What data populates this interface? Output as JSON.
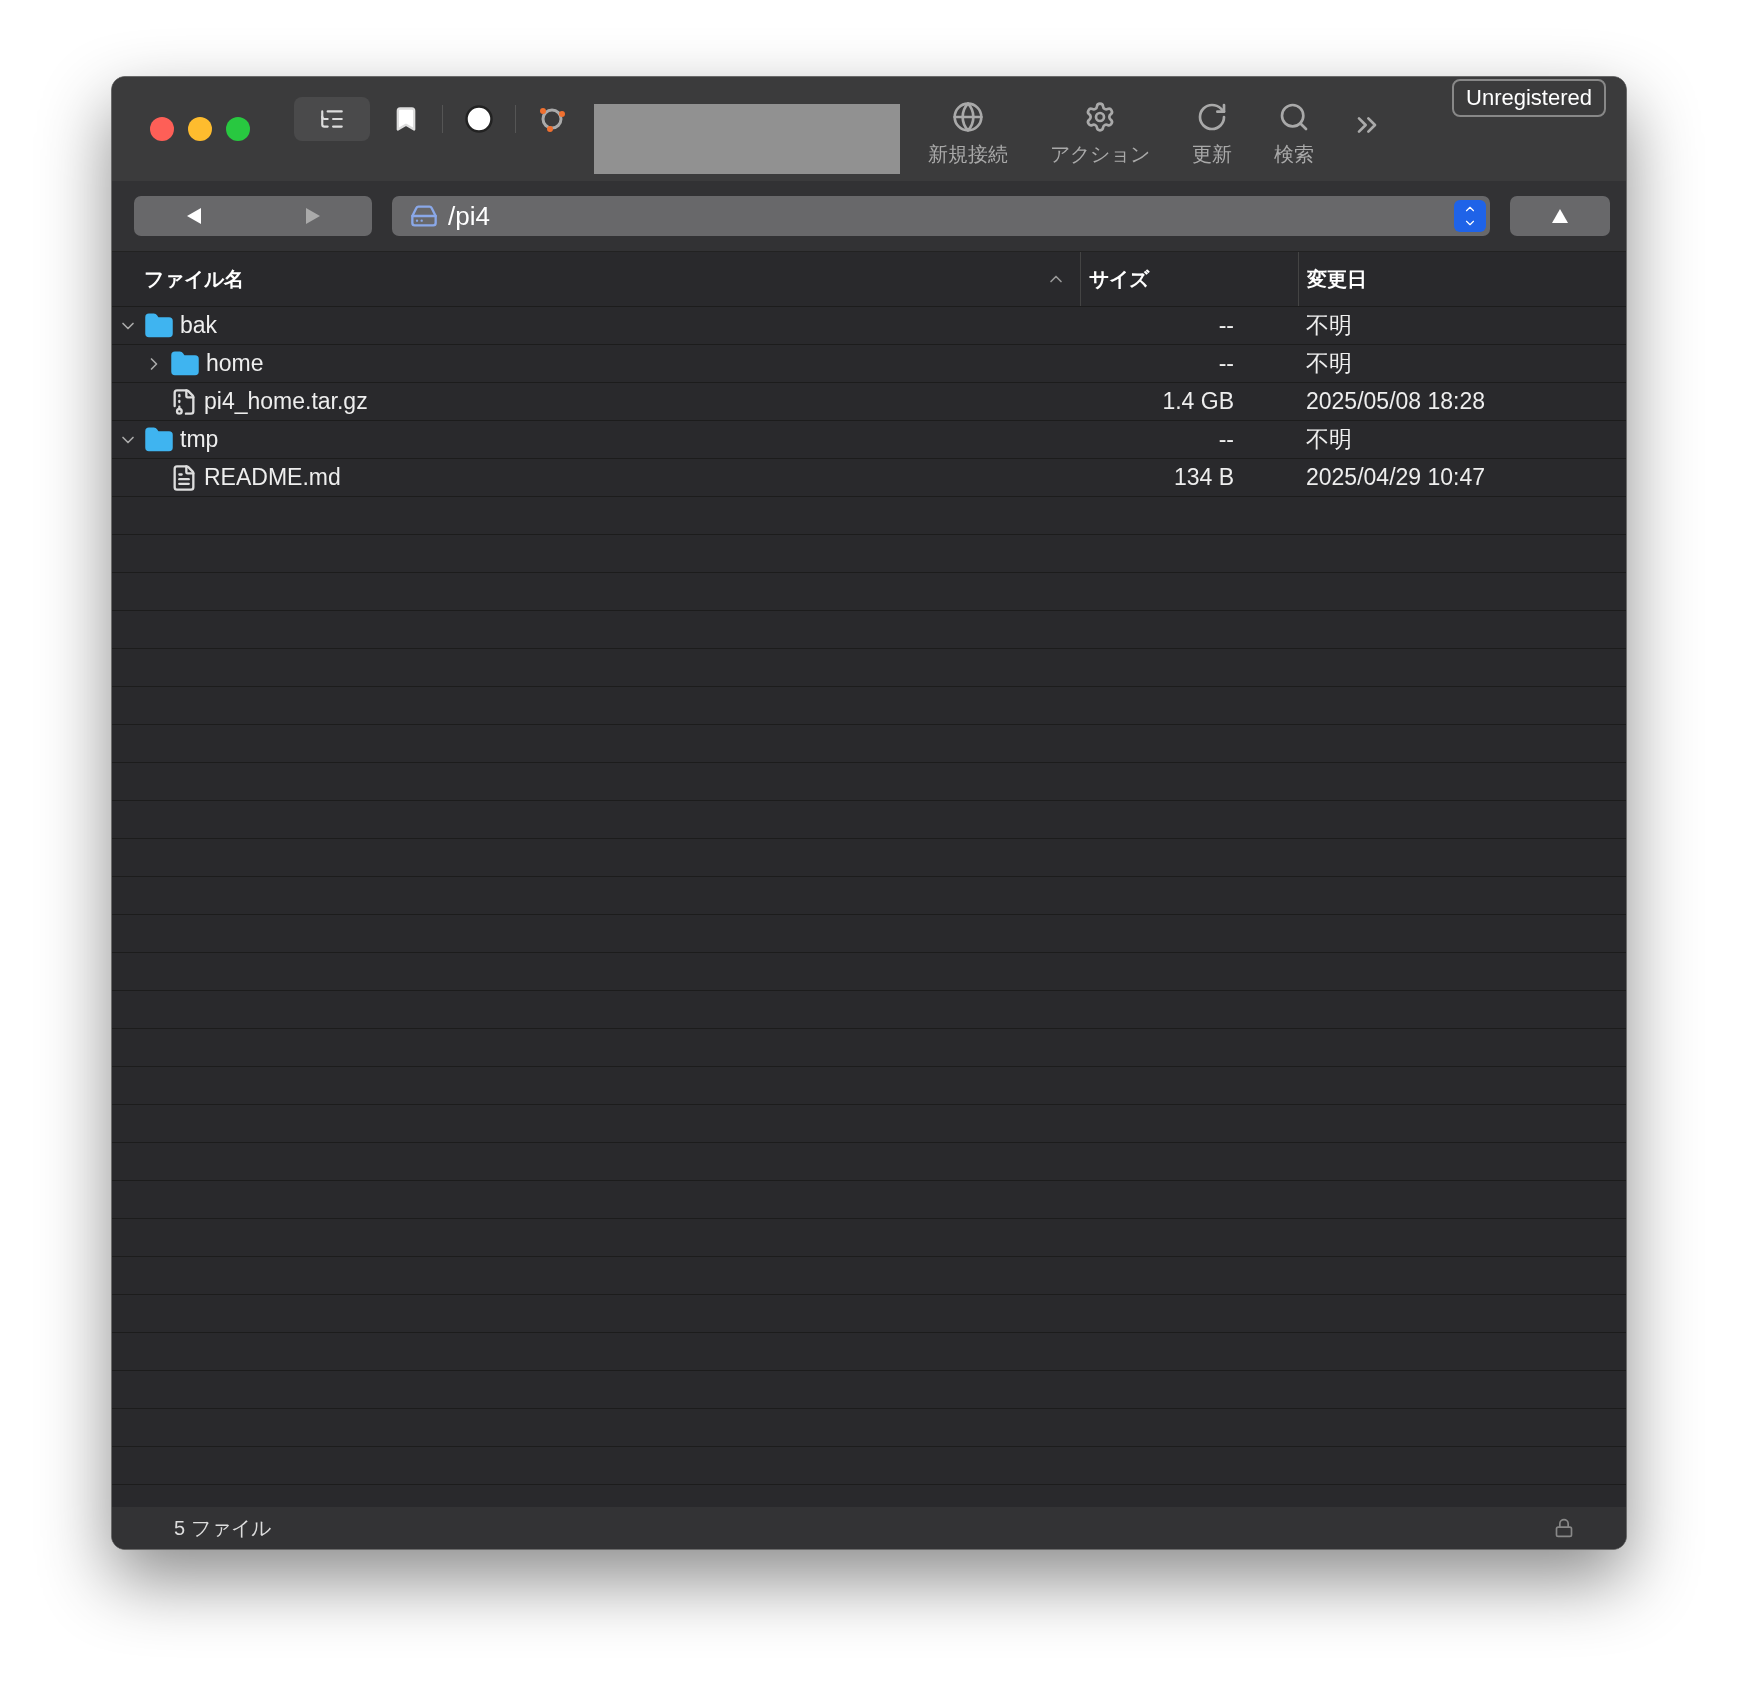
{
  "toolbar": {
    "buttons": [
      {
        "label": "新規接続",
        "kind": "globe"
      },
      {
        "label": "アクション",
        "kind": "gear"
      },
      {
        "label": "更新",
        "kind": "refresh"
      },
      {
        "label": "検索",
        "kind": "search"
      }
    ],
    "badge": "Unregistered"
  },
  "path_bar": {
    "path": "/pi4"
  },
  "table": {
    "columns": [
      {
        "label": "ファイル名",
        "sorted": true
      },
      {
        "label": "サイズ",
        "sorted": false
      },
      {
        "label": "変更日",
        "sorted": false
      }
    ],
    "rows": [
      {
        "name": "bak",
        "kind": "folder",
        "expanded": true,
        "size": "--",
        "modified": "不明",
        "children": [
          {
            "name": "home",
            "kind": "folder",
            "expanded": false,
            "size": "--",
            "modified": "不明"
          },
          {
            "name": "pi4_home.tar.gz",
            "kind": "archive",
            "size": "1.4 GB",
            "modified": "2025/05/08 18:28"
          }
        ]
      },
      {
        "name": "tmp",
        "kind": "folder",
        "expanded": true,
        "size": "--",
        "modified": "不明",
        "children": [
          {
            "name": "README.md",
            "kind": "document",
            "size": "134 B",
            "modified": "2025/04/29 10:47"
          }
        ]
      }
    ]
  },
  "status_bar": {
    "text": "5 ファイル"
  }
}
